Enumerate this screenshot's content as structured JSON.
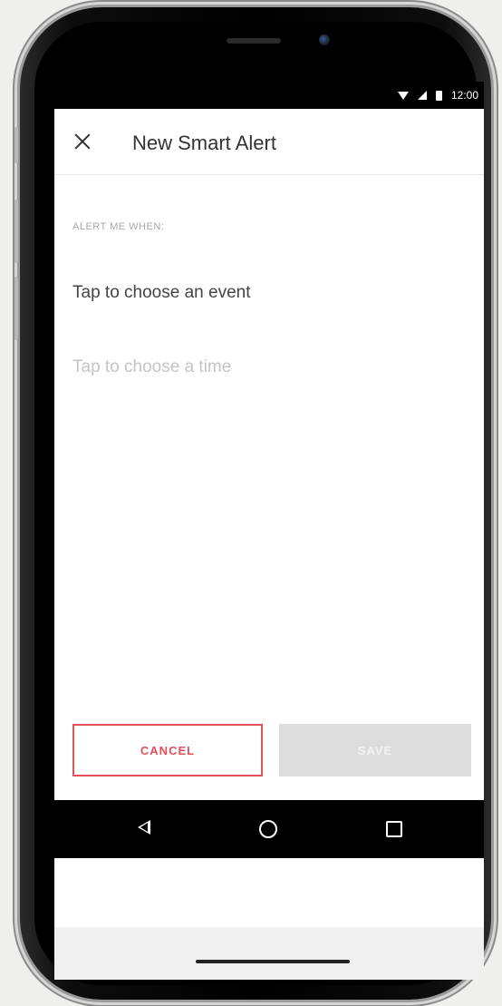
{
  "status_bar": {
    "time": "12:00",
    "icons": [
      "wifi-icon",
      "signal-icon",
      "battery-icon"
    ]
  },
  "header": {
    "title": "New Smart Alert",
    "close_icon": "close-icon"
  },
  "form": {
    "section_label": "ALERT ME WHEN:",
    "event_prompt": "Tap to choose an event",
    "time_prompt": "Tap to choose a time"
  },
  "actions": {
    "cancel_label": "CANCEL",
    "save_label": "SAVE"
  },
  "nav_bar": {
    "icons": [
      "back-icon",
      "home-icon",
      "recents-icon"
    ]
  },
  "colors": {
    "accent": "#e6505a",
    "disabled_button": "#dcdcdc",
    "background": "#efefee"
  }
}
